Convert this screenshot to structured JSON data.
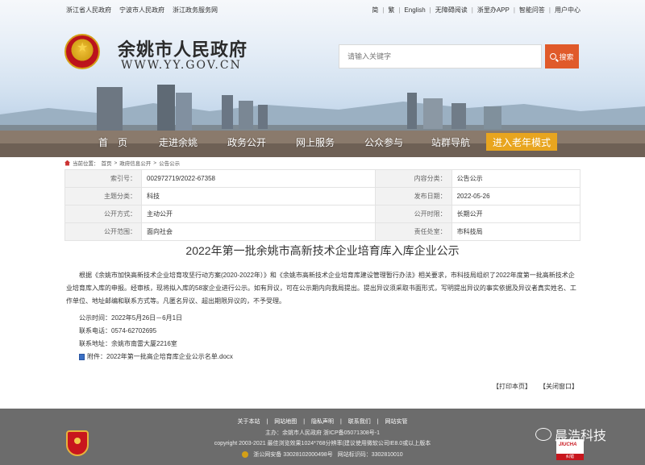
{
  "topbar": {
    "left_links": [
      "浙江省人民政府",
      "宁波市人民政府",
      "浙江政务服务网"
    ],
    "right_links": [
      "简",
      "繁",
      "English",
      "无障碍阅读",
      "浙里办APP",
      "智能问答",
      "用户中心"
    ]
  },
  "header": {
    "site_title": "余姚市人民政府",
    "site_url": "WWW.YY.GOV.CN",
    "search_placeholder": "请输入关键字",
    "search_button": "搜索"
  },
  "nav": {
    "items": [
      "首　页",
      "走进余姚",
      "政务公开",
      "网上服务",
      "公众参与",
      "站群导航"
    ],
    "elder_mode": "进入老年模式"
  },
  "breadcrumb": {
    "prefix": "当前位置：",
    "items": [
      "首页",
      "政府信息公开",
      "公告公示"
    ],
    "separator": ">"
  },
  "info": {
    "rows": [
      {
        "k1": "索引号：",
        "v1": "002972719/2022-67358",
        "k2": "内容分类：",
        "v2": "公告公示"
      },
      {
        "k1": "主题分类：",
        "v1": "科技",
        "k2": "发布日期：",
        "v2": "2022-05-26"
      },
      {
        "k1": "公开方式：",
        "v1": "主动公开",
        "k2": "公开时限：",
        "v2": "长期公开"
      },
      {
        "k1": "公开范围：",
        "v1": "面向社会",
        "k2": "责任处室：",
        "v2": "市科技局"
      }
    ]
  },
  "article": {
    "title": "2022年第一批余姚市高新技术企业培育库入库企业公示",
    "body": "根据《余姚市加快高新技术企业培育攻坚行动方案(2020-2022年）》和《余姚市高新技术企业培育库建设管理暂行办法》相关要求，市科技局组织了2022年度第一批高新技术企业培育库入库的申报。经审核，现将拟入库的58家企业进行公示。如有异议，可在公示期内向我局提出。提出异议须采取书面形式，写明提出异议的事实依据及异议者真实姓名、工作单位、地址邮编和联系方式等。凡匿名异议、超出期限异议的，不予受理。",
    "period": "公示时间：2022年5月26日－6月1日",
    "phone": "联系电话：0574-62702695",
    "address": "联系地址：余姚市南雷大厦2216室",
    "attachment": "附件：2022年第一批高企培育库企业公示名单.docx",
    "print": "【打印本页】",
    "close": "【关闭窗口】"
  },
  "footer": {
    "links": [
      "关于本站",
      "网站地图",
      "隐私声明",
      "联系我们",
      "网站实管"
    ],
    "line2": "主办：余姚市人民政府 浙ICP备05071308号-1",
    "line3": "copyright 2003-2021 最佳浏览效果1024*768分辨率(建议使用微软公司IE8.0或以上版本",
    "police": "浙公网安备 33028102000498号",
    "site_id": "网站标识码：3302810010",
    "gov_badge_text": "JIUCHA",
    "gov_badge_label": "纠错",
    "watermark": "晨浩科技"
  },
  "colors": {
    "nav_elder_bg": "#e8a51f",
    "search_button_bg": "#e05a2a",
    "footer_bg": "#6c6c6c",
    "brand_red": "#c8161d"
  }
}
